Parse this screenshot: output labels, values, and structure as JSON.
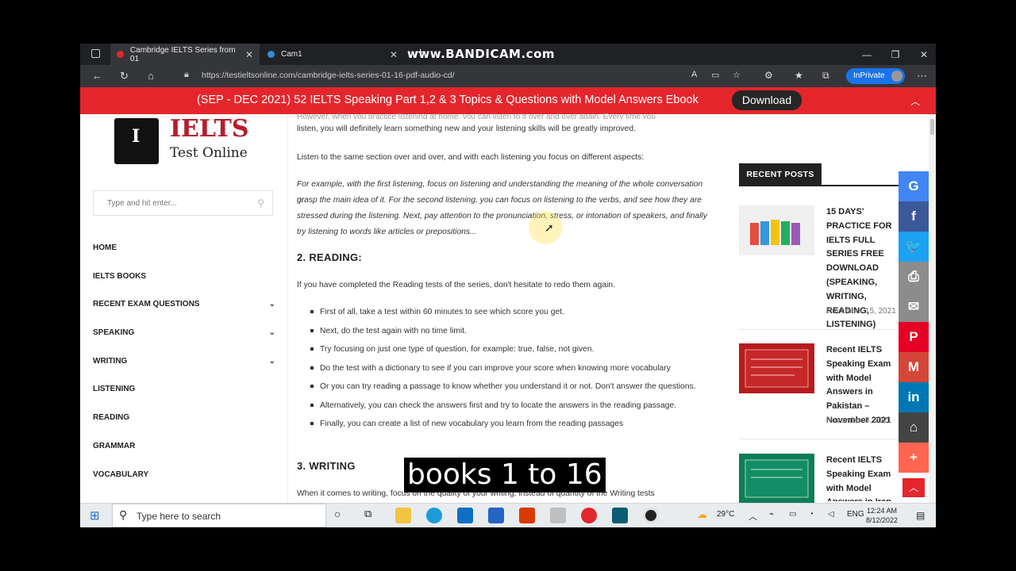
{
  "browser": {
    "tabs": [
      {
        "title": "Cambridge IELTS Series from 01",
        "active": true
      },
      {
        "title": "Cam1",
        "active": false
      }
    ],
    "new_tab": "+",
    "watermark": "www.BANDICAM.com",
    "url": "https://testieltsonline.com/cambridge-ielts-series-01-16-pdf-audio-cd/",
    "inprivate_label": "InPrivate"
  },
  "banner": {
    "text": "(SEP - DEC 2021) 52 IELTS Speaking Part 1,2 & 3 Topics & Questions with Model Answers Ebook",
    "button": "Download"
  },
  "site": {
    "logo_title": "IELTS",
    "logo_subtitle": "Test Online",
    "logo_letter": "I",
    "search_placeholder": "Type and hit enter...",
    "nav": [
      {
        "label": "HOME",
        "has_submenu": false
      },
      {
        "label": "IELTS BOOKS",
        "has_submenu": false
      },
      {
        "label": "RECENT EXAM QUESTIONS",
        "has_submenu": true
      },
      {
        "label": "SPEAKING",
        "has_submenu": true
      },
      {
        "label": "WRITING",
        "has_submenu": true
      },
      {
        "label": "LISTENING",
        "has_submenu": false
      },
      {
        "label": "READING",
        "has_submenu": false
      },
      {
        "label": "GRAMMAR",
        "has_submenu": false
      },
      {
        "label": "VOCABULARY",
        "has_submenu": false
      }
    ]
  },
  "article": {
    "p0": "listen, you will definitely learn something new and your listening skills will be greatly improved.",
    "p1": "Listen to the same section over and over, and with each listening you focus on different aspects:",
    "p2_lines": [
      "For example, with the first listening, focus on listening and understanding the meaning of the whole conversation or",
      "grasp the main idea of it. For the second listening, you can focus on listening to the verbs, and see how they are",
      "stressed during the listening. Next, pay attention to the pronunciation, stress, or intonation of speakers, and finally",
      "try listening to words like articles or prepositions..."
    ],
    "h_reading": "2. READING:",
    "p3": "If you have completed the Reading tests of the series, don't hesitate to redo them again.",
    "bullets": [
      "First of all, take a test within 60 minutes to see which score you get.",
      "Next, do the test again with no time limit.",
      "Try focusing on just one type of question, for example: true, false, not given.",
      "Do the test with a dictionary to see if you can improve your score when knowing more vocabulary",
      "Or you can try reading a passage to know whether you understand it or not. Don't answer the questions.",
      "Alternatively, you can check the answers first and try to locate the answers in the reading passage.",
      "Finally, you can create a list of new vocabulary you learn from the reading passages"
    ],
    "h_writing": "3. WRITING",
    "p4": "When it comes to writing, focus on the quality of your writing, instead of quantity of the Writing tests"
  },
  "recent_posts": {
    "heading": "RECENT POSTS",
    "items": [
      {
        "title": "15 DAYS' PRACTICE FOR IELTS FULL SERIES FREE DOWNLOAD (SPEAKING, WRITING, READING, LISTENING)",
        "date": "November 15, 2021"
      },
      {
        "title": "Recent IELTS Speaking Exam with Model Answers in Pakistan – November 2021",
        "date": "November 8, 2021"
      },
      {
        "title": "Recent IELTS Speaking Exam with Model Answers in Iran – November",
        "date": ""
      }
    ]
  },
  "share": [
    {
      "icon": "google-icon",
      "glyph": "G",
      "color": "#4285f4"
    },
    {
      "icon": "facebook-icon",
      "glyph": "f",
      "color": "#3b5998"
    },
    {
      "icon": "twitter-icon",
      "glyph": "🐦",
      "color": "#1da1f2"
    },
    {
      "icon": "print-icon",
      "glyph": "⎙",
      "color": "#8c8c8c"
    },
    {
      "icon": "email-icon",
      "glyph": "✉",
      "color": "#8c8c8c"
    },
    {
      "icon": "pinterest-icon",
      "glyph": "P",
      "color": "#e60023"
    },
    {
      "icon": "gmail-icon",
      "glyph": "M",
      "color": "#d44638"
    },
    {
      "icon": "linkedin-icon",
      "glyph": "in",
      "color": "#0077b5"
    },
    {
      "icon": "tumblr-icon",
      "glyph": "⌂",
      "color": "#444"
    },
    {
      "icon": "more-icon",
      "glyph": "+",
      "color": "#ff6550"
    }
  ],
  "caption": "books 1 to 16",
  "taskbar": {
    "search_placeholder": "Type here to search",
    "temperature": "29°C",
    "lang": "ENG",
    "time": "12:24 AM",
    "date": "8/12/2022"
  }
}
